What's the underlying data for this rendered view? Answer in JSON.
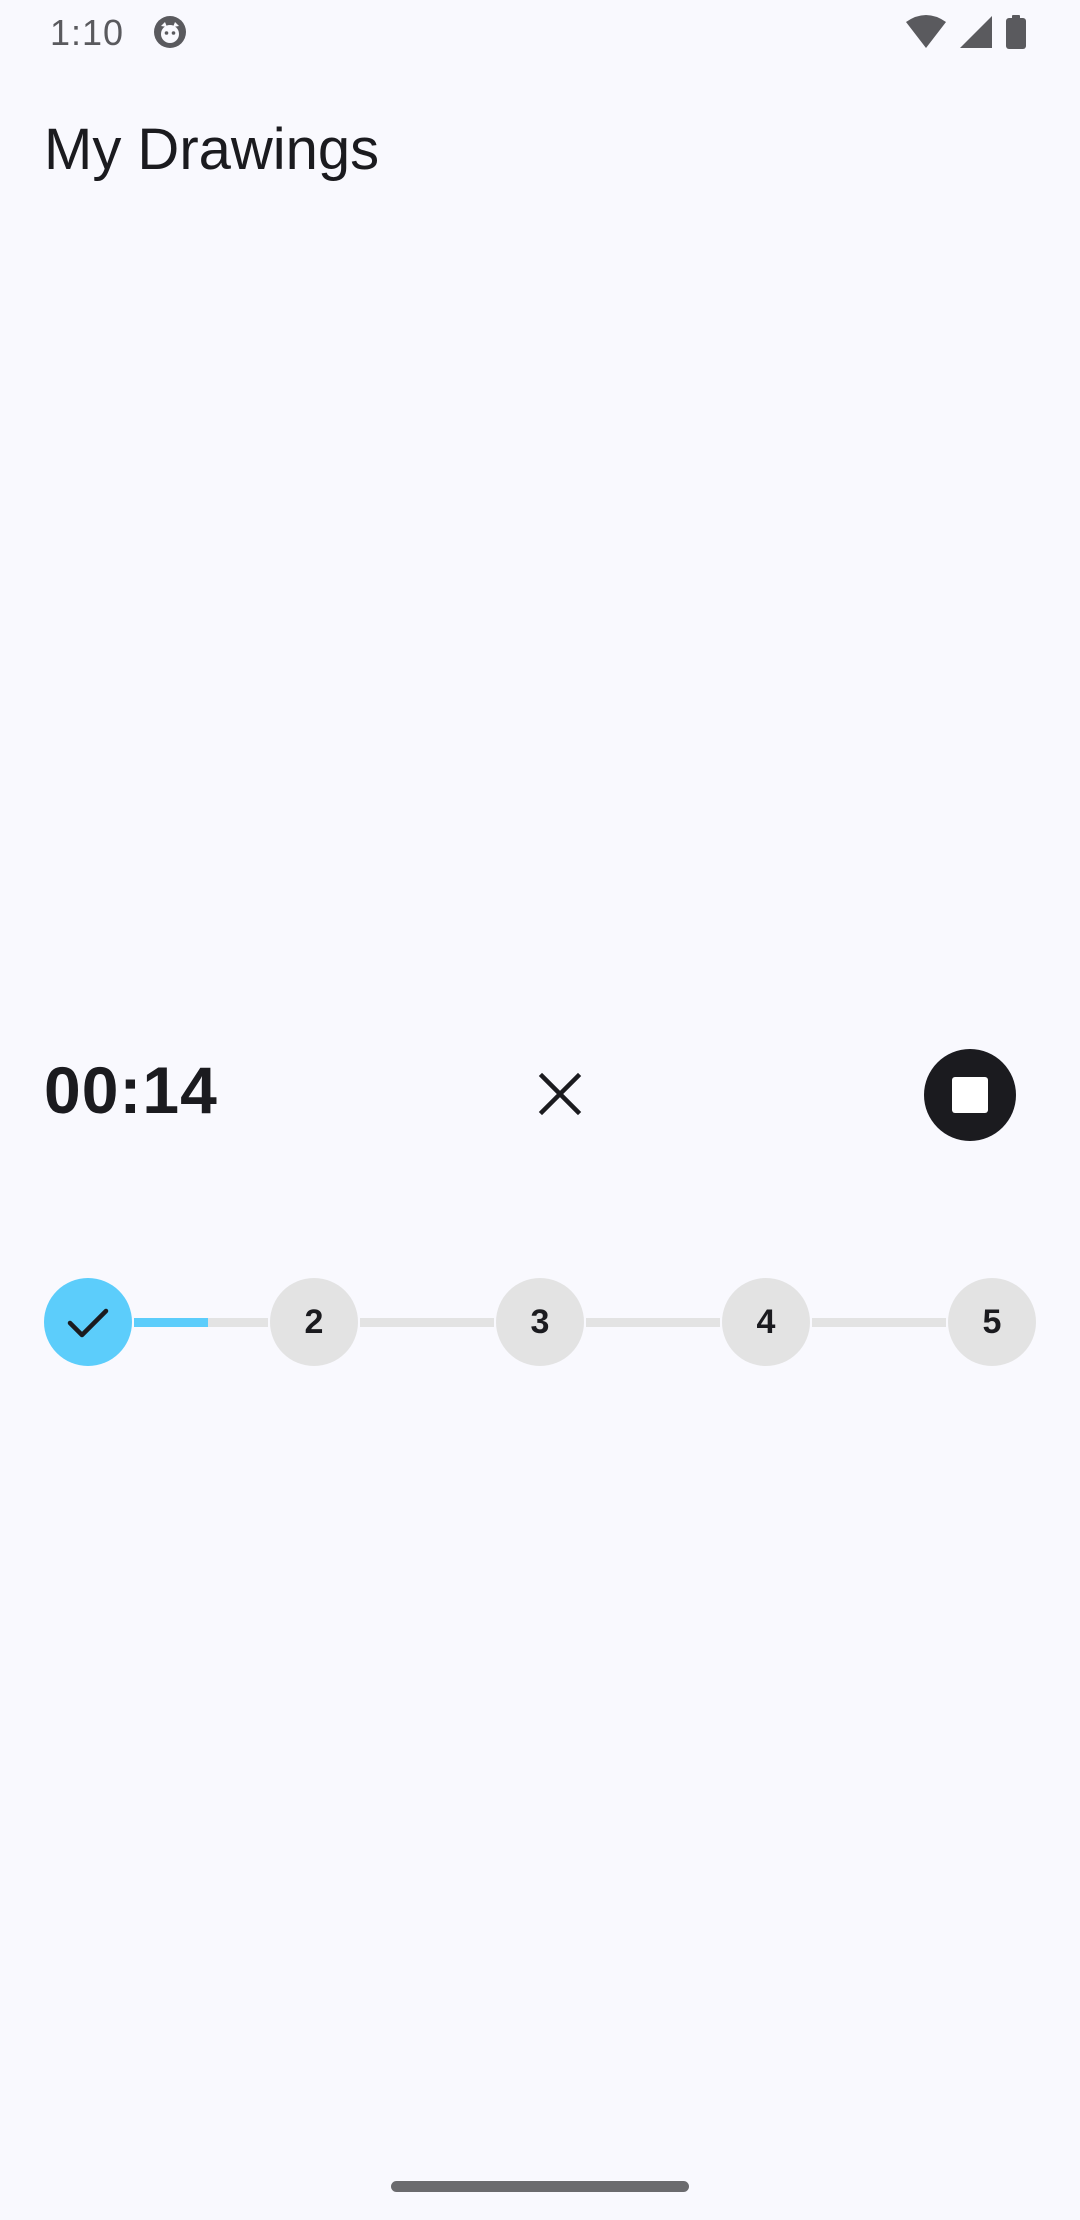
{
  "status_bar": {
    "time": "1:10",
    "icons": [
      "app-notification-icon",
      "wifi-icon",
      "cellular-signal-icon",
      "battery-icon"
    ]
  },
  "title": "My Drawings",
  "recorder": {
    "elapsed": "00:14",
    "cancel_icon": "close-icon",
    "stop_icon": "stop-icon"
  },
  "stepper": {
    "steps": [
      {
        "label": "",
        "state": "completed",
        "icon": "check-icon"
      },
      {
        "label": "2",
        "state": "pending"
      },
      {
        "label": "3",
        "state": "pending"
      },
      {
        "label": "4",
        "state": "pending"
      },
      {
        "label": "5",
        "state": "pending"
      }
    ],
    "current_connector_progress": 0.55
  },
  "colors": {
    "background": "#f9f9fe",
    "accent": "#5ccdfb",
    "inactive": "#e3e3e3",
    "text": "#1b1b1f"
  }
}
